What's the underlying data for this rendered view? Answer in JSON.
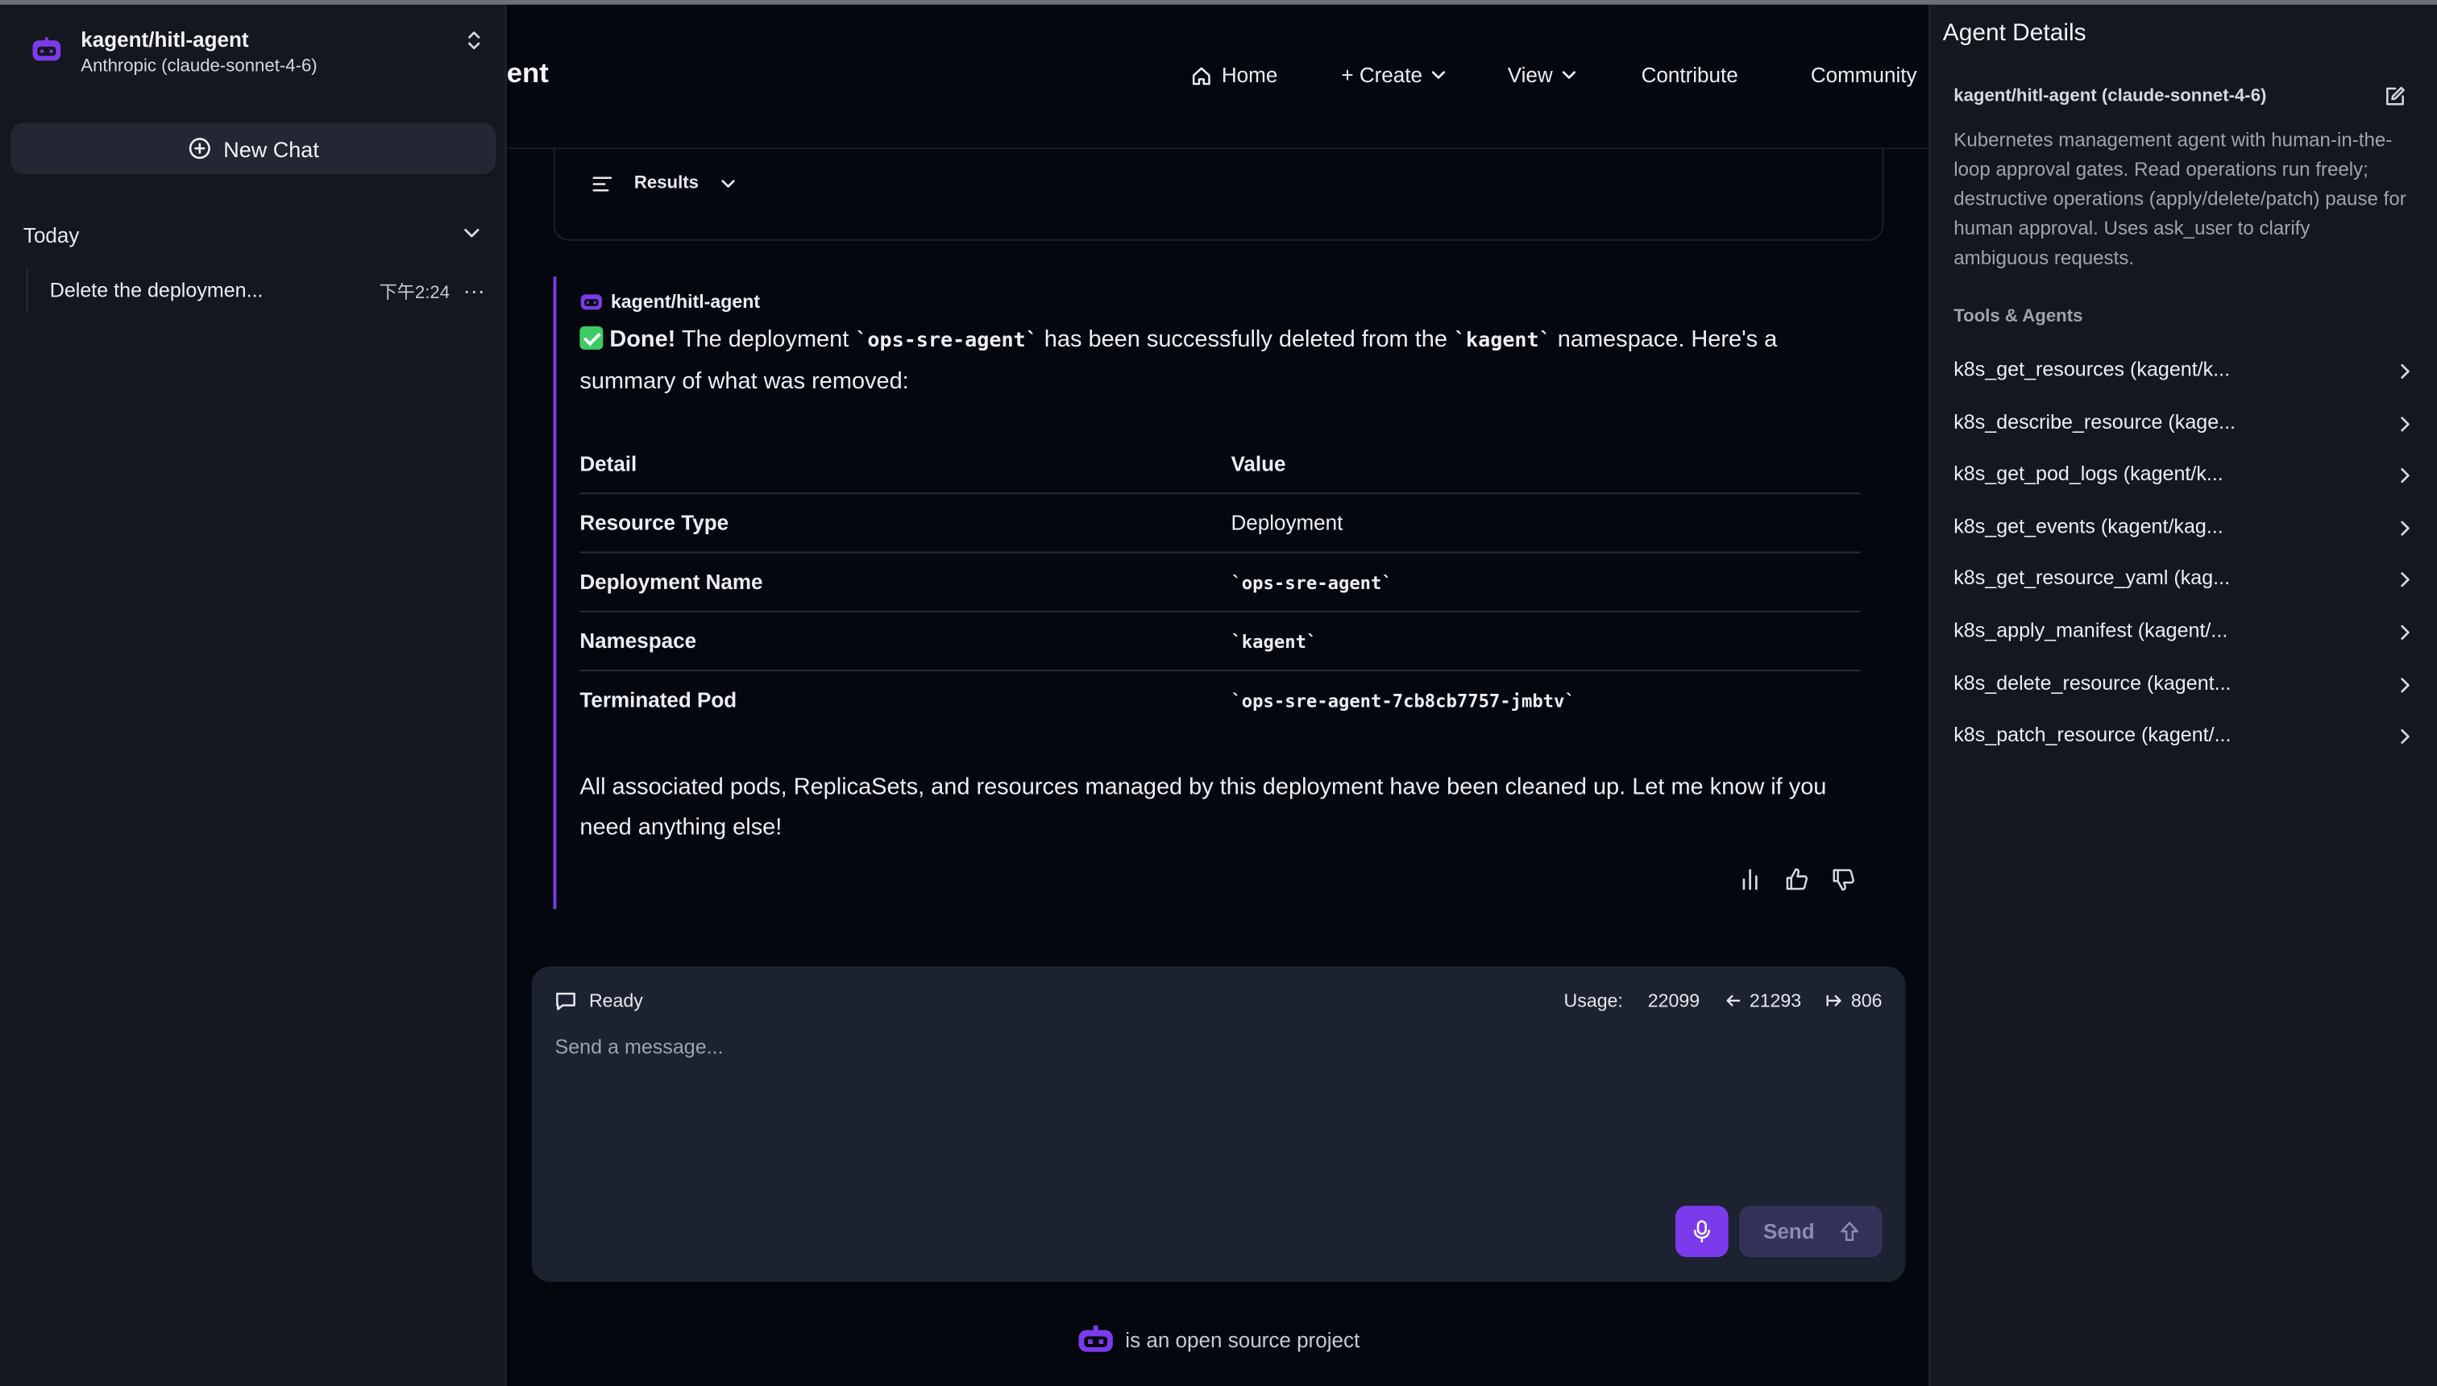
{
  "sidebar": {
    "agent_name": "kagent/hitl-agent",
    "agent_model": "Anthropic (claude-sonnet-4-6)",
    "new_chat_label": "New Chat",
    "section_label": "Today",
    "chats": [
      {
        "title": "Delete the deploymen...",
        "time": "下午2:24",
        "more": "···"
      }
    ]
  },
  "header": {
    "brand_fragment": "ent",
    "nav": {
      "home": "Home",
      "create": "+ Create",
      "view": "View",
      "contribute": "Contribute",
      "community": "Community"
    }
  },
  "results_label": "Results",
  "message": {
    "sender": "kagent/hitl-agent",
    "done": "Done!",
    "intro_1": " The deployment ",
    "deployment": "`ops-sre-agent`",
    "intro_2": " has been successfully deleted from the ",
    "namespace": "`kagent`",
    "intro_3": " namespace. Here's a summary of what was removed:",
    "table": {
      "headers": [
        "Detail",
        "Value"
      ],
      "rows": [
        [
          "Resource Type",
          "Deployment"
        ],
        [
          "Deployment Name",
          "`ops-sre-agent`"
        ],
        [
          "Namespace",
          "`kagent`"
        ],
        [
          "Terminated Pod",
          "`ops-sre-agent-7cb8cb7757-jmbtv`"
        ]
      ]
    },
    "outro": "All associated pods, ReplicaSets, and resources managed by this deployment have been cleaned up. Let me know if you need anything else!"
  },
  "composer": {
    "status": "Ready",
    "usage_label": "Usage:",
    "usage_total": "22099",
    "usage_in": "21293",
    "usage_out": "806",
    "placeholder": "Send a message...",
    "send_label": "Send"
  },
  "footer_text": "is an open source project",
  "details": {
    "title": "Agent Details",
    "agent": "kagent/hitl-agent (claude-sonnet-4-6)",
    "description": "Kubernetes management agent with human-in-the-loop approval gates. Read operations run freely; destructive operations (apply/delete/patch) pause for human approval. Uses ask_user to clarify ambiguous requests.",
    "tools_label": "Tools & Agents",
    "tools": [
      "k8s_get_resources (kagent/k...",
      "k8s_describe_resource (kage...",
      "k8s_get_pod_logs (kagent/k...",
      "k8s_get_events (kagent/kag...",
      "k8s_get_resource_yaml (kag...",
      "k8s_apply_manifest (kagent/...",
      "k8s_delete_resource (kagent...",
      "k8s_patch_resource (kagent/..."
    ]
  },
  "colors": {
    "accent": "#7c3aed",
    "background": "#05070e",
    "panel": "#15171f",
    "composer": "#1d2230",
    "check": "#3ecb66"
  },
  "icons": [
    "kagent-logo-icon",
    "updown-icon",
    "plus-circle-icon",
    "chevron-down-icon",
    "home-icon",
    "list-icon",
    "chat-bubble-icon",
    "arrow-left-icon",
    "arrow-right-icon",
    "mic-icon",
    "arrow-up-icon",
    "bar-chart-icon",
    "thumbs-up-icon",
    "thumbs-down-icon",
    "edit-icon",
    "chevron-right-icon"
  ]
}
